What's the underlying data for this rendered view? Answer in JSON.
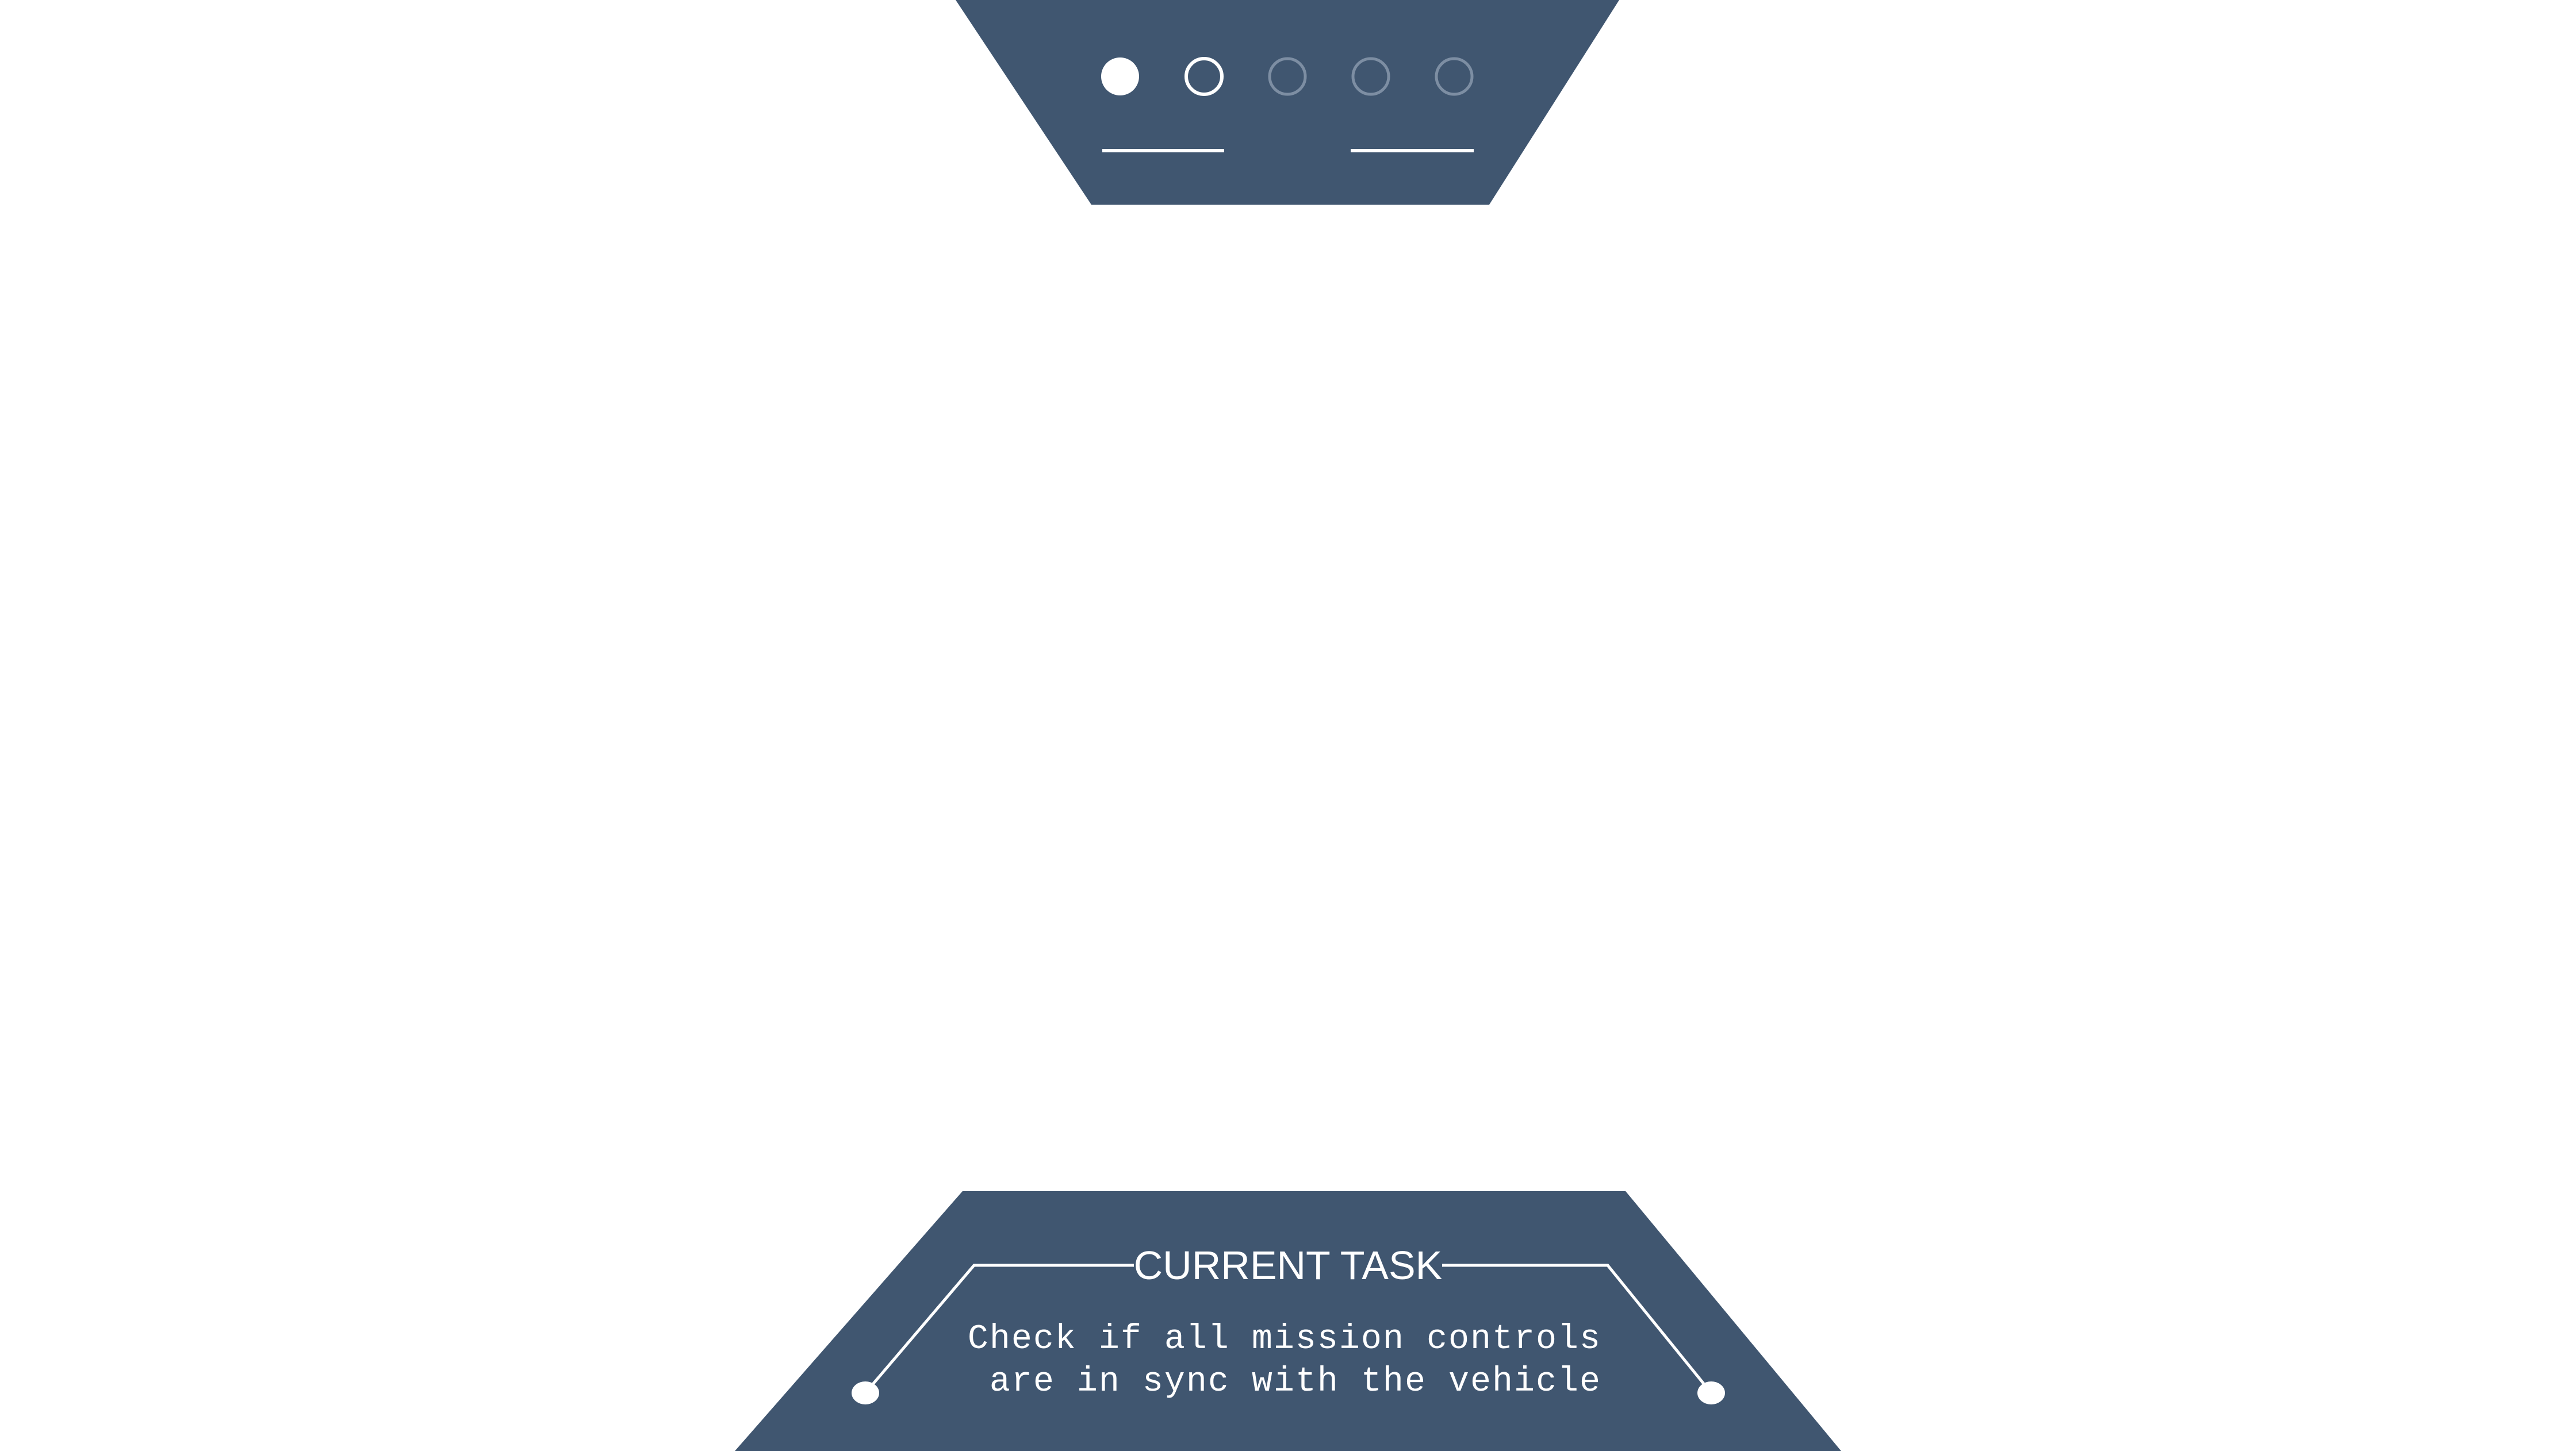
{
  "theme": {
    "panel_color": "#405670",
    "accent_color": "#ffffff",
    "inactive_dot_color": "#7d8ea3"
  },
  "step_indicator": {
    "total_steps": 5,
    "current_step": 1,
    "steps": [
      {
        "state": "active"
      },
      {
        "state": "visited"
      },
      {
        "state": "inactive"
      },
      {
        "state": "inactive"
      },
      {
        "state": "inactive"
      }
    ]
  },
  "task_panel": {
    "title": "CURRENT TASK",
    "line1": "Check if all mission controls",
    "line2": "are in sync with the vehicle"
  }
}
